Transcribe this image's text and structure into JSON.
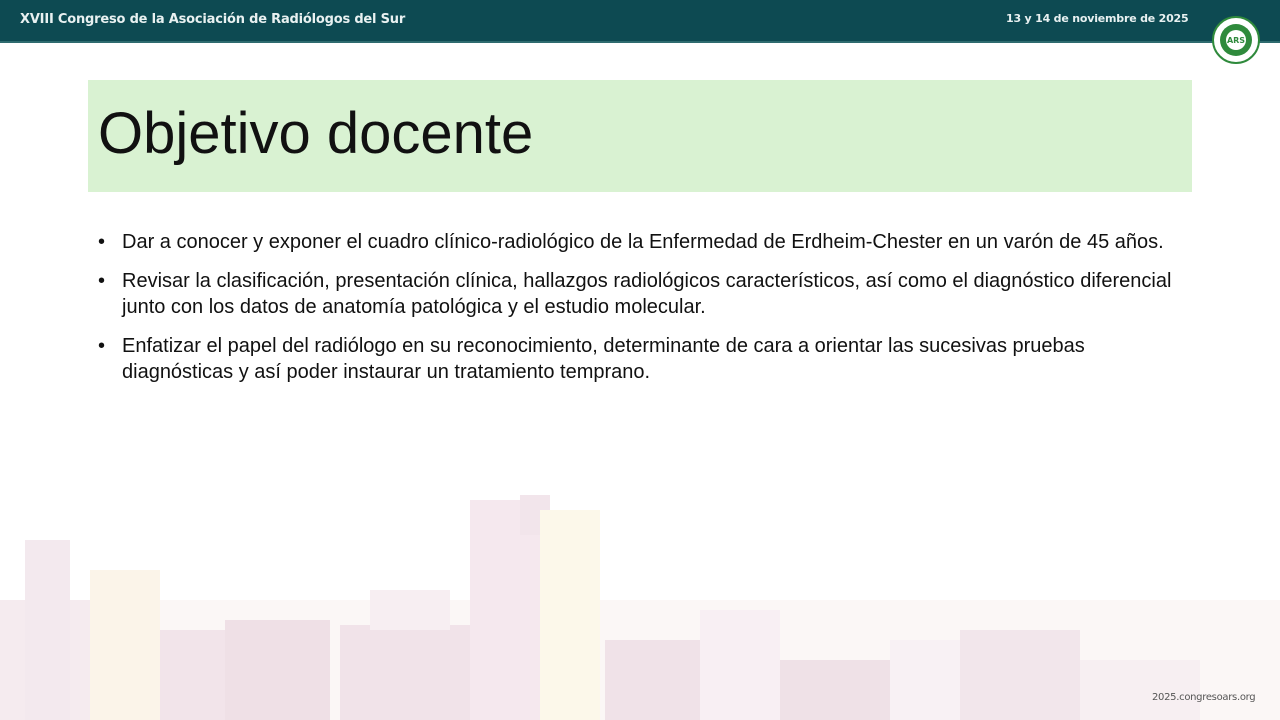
{
  "header": {
    "congress_title": "XVIII Congreso de la Asociación de Radiólogos del Sur",
    "dates": "13 y 14 de noviembre de 2025",
    "logo_text": "ARS"
  },
  "slide": {
    "title": "Objetivo docente",
    "bullets": [
      "Dar a conocer y exponer el cuadro clínico-radiológico de la  Enfermedad de Erdheim-Chester en un varón de 45 años.",
      "Revisar la clasificación, presentación clínica, hallazgos radiológicos característicos, así como el diagnóstico diferencial junto con los datos de anatomía patológica y el estudio molecular.",
      "Enfatizar el papel del radiólogo en su reconocimiento, determinante de cara a orientar las sucesivas pruebas diagnósticas y así poder instaurar un tratamiento temprano."
    ]
  },
  "footer": {
    "url": "2025.congresoars.org"
  },
  "colors": {
    "header_bg": "#0d4a52",
    "title_bg": "#d9f2d2",
    "logo_green": "#2f8a3c"
  }
}
